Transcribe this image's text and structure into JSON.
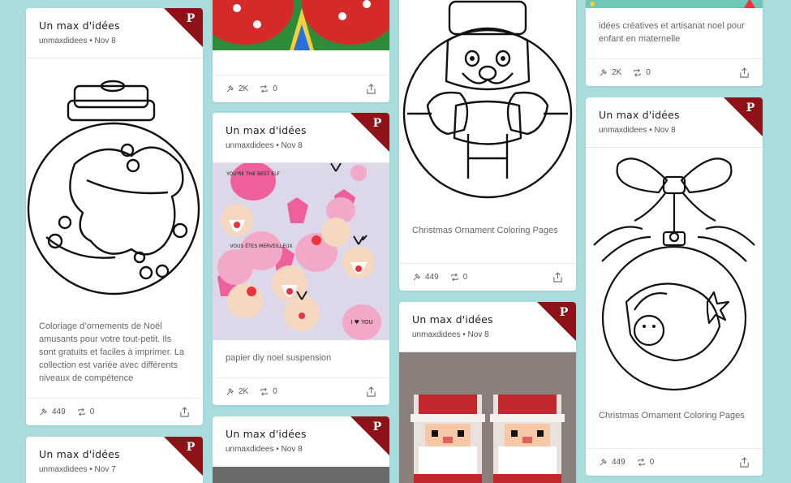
{
  "colors": {
    "background": "#a9dcdd",
    "accent": "#8e1218"
  },
  "cards": [
    {
      "title": "Un max d'idées",
      "author": "unmaxdidees",
      "date": "Nov 8",
      "caption": "Coloriage d’ornements de Noël amusants pour votre tout-petit. Ils sont gratuits et faciles à imprimer. La collection est variée avec différents niveaux de compétence",
      "repins": "449",
      "comments": "0"
    },
    {
      "caption": "",
      "repins": "2K",
      "comments": "0"
    },
    {
      "title": "Un max d'idées",
      "author": "unmaxdidees",
      "date": "Nov 8",
      "caption": "papier diy noel suspension",
      "repins": "2K",
      "comments": "0"
    },
    {
      "caption": "Christmas Ornament Coloring Pages",
      "repins": "449",
      "comments": "0"
    },
    {
      "caption": "idées créatives et artisanat noel pour enfant en maternelle",
      "repins": "2K",
      "comments": "0"
    },
    {
      "title": "Un max d'idées",
      "author": "unmaxdidees",
      "date": "Nov 8",
      "caption": "Christmas Ornament Coloring Pages",
      "repins": "449",
      "comments": "0"
    },
    {
      "title": "Un max d'idées",
      "author": "unmaxdidees",
      "date": "Nov 7"
    },
    {
      "title": "Un max d'idées",
      "author": "unmaxdidees",
      "date": "Nov 8"
    },
    {
      "title": "Un max d'idées",
      "author": "unmaxdidees",
      "date": "Nov 8"
    }
  ],
  "images": {
    "vous_etes": "VOUS ÊTES MERVEILLEUX",
    "best_elf": "YOU'RE THE BEST ELF",
    "i_love_you": "I ♥ YOU"
  },
  "icons": {
    "corner": "pinterest-p-icon",
    "repin": "pin-icon",
    "comment": "retweet-icon",
    "share": "share-icon"
  }
}
